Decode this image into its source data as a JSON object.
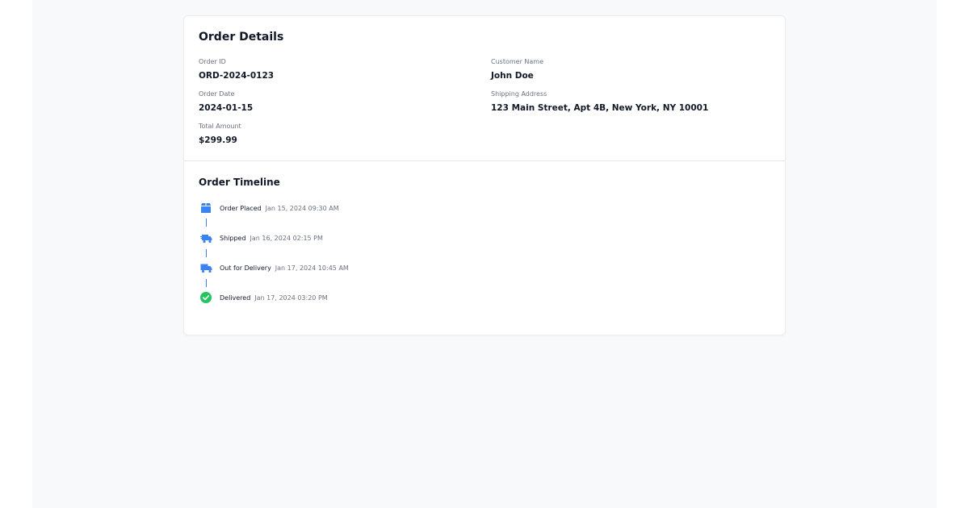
{
  "order": {
    "title": "Order Details",
    "fields": {
      "order_id": {
        "label": "Order ID",
        "value": "ORD-2024-0123"
      },
      "customer_name": {
        "label": "Customer Name",
        "value": "John Doe"
      },
      "order_date": {
        "label": "Order Date",
        "value": "2024-01-15"
      },
      "shipping_address": {
        "label": "Shipping Address",
        "value": "123 Main Street, Apt 4B, New York, NY 10001"
      },
      "total_amount": {
        "label": "Total Amount",
        "value": "$299.99"
      }
    }
  },
  "timeline": {
    "title": "Order Timeline",
    "events": [
      {
        "label": "Order Placed",
        "time": "Jan 15, 2024 09:30 AM",
        "icon": "box-icon"
      },
      {
        "label": "Shipped",
        "time": "Jan 16, 2024 02:15 PM",
        "icon": "shipping-fast-icon"
      },
      {
        "label": "Out for Delivery",
        "time": "Jan 17, 2024 10:45 AM",
        "icon": "truck-icon"
      },
      {
        "label": "Delivered",
        "time": "Jan 17, 2024 03:20 PM",
        "icon": "check-circle-icon"
      }
    ]
  },
  "colors": {
    "accent": "#3b82f6",
    "success": "#22c55e",
    "text": "#111827",
    "muted": "#6b7280",
    "background": "#f8f9fb"
  }
}
